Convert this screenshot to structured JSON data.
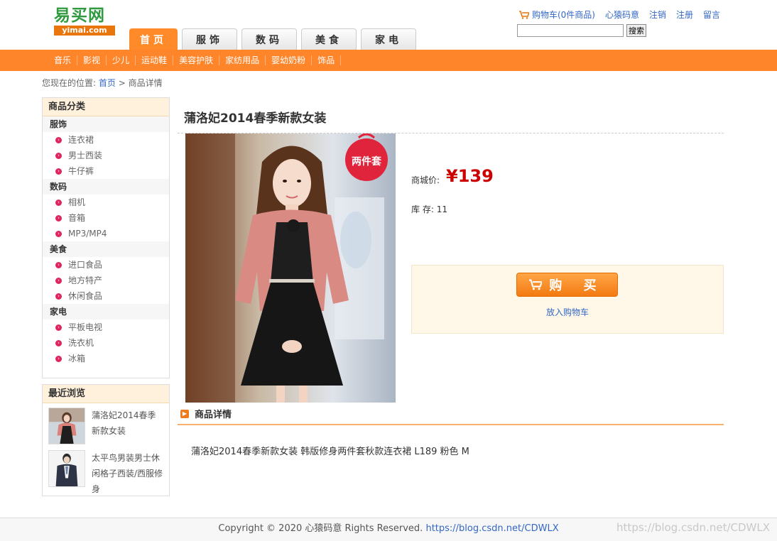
{
  "site": {
    "logo_cn": "易买网",
    "logo_en": "yimai.com"
  },
  "nav": {
    "tabs": [
      "首页",
      "服饰",
      "数码",
      "美食",
      "家电"
    ],
    "active_tab": 0
  },
  "userbar": {
    "cart": "购物车(0件商品)",
    "user": "心猿码意",
    "logout": "注销",
    "register": "注册",
    "message": "留言"
  },
  "search": {
    "value": "",
    "button": "搜索"
  },
  "subnav": [
    "音乐",
    "影视",
    "少儿",
    "运动鞋",
    "美容护肤",
    "家纺用品",
    "婴幼奶粉",
    "饰品"
  ],
  "breadcrumb": {
    "prefix": "您现在的位置:",
    "home": "首页",
    "sep": ">",
    "current": "商品详情"
  },
  "sidebar": {
    "category_title": "商品分类",
    "categories": [
      {
        "name": "服饰",
        "items": [
          "连衣裙",
          "男士西装",
          "牛仔裤"
        ]
      },
      {
        "name": "数码",
        "items": [
          "相机",
          "音箱",
          "MP3/MP4"
        ]
      },
      {
        "name": "美食",
        "items": [
          "进口食品",
          "地方特产",
          "休闲食品"
        ]
      },
      {
        "name": "家电",
        "items": [
          "平板电视",
          "洗衣机",
          "冰箱"
        ]
      }
    ],
    "recent_title": "最近浏览",
    "recent": [
      {
        "name": "蒲洛妃2014春季新款女装"
      },
      {
        "name": "太平鸟男装男士休闲格子西装/西服修身"
      }
    ]
  },
  "product": {
    "title": "蒲洛妃2014春季新款女装",
    "badge": "两件套",
    "price_label": "商城价:",
    "price": "¥139",
    "stock_label": "库 存:",
    "stock": "11",
    "buy_button": "购 买",
    "add_cart": "放入购物车",
    "detail_title": "商品详情",
    "description": "蒲洛妃2014春季新款女装 韩版修身两件套秋款连衣裙 L189 粉色 M"
  },
  "footer": {
    "copyright": "Copyright © 2020 心猿码意 Rights Reserved.",
    "link": "https://blog.csdn.net/CDWLX"
  },
  "watermark": "https://blog.csdn.net/CDWLX",
  "colors": {
    "accent": "#ff852a",
    "price": "#cc0000",
    "link": "#3367c5",
    "logo_green": "#2f9a3f"
  }
}
